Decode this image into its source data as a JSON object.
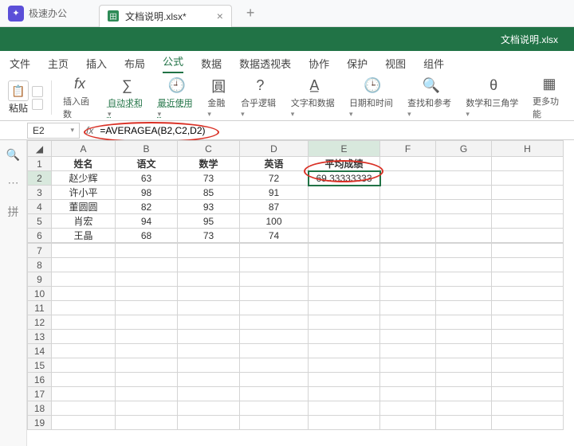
{
  "app": {
    "name": "极速办公"
  },
  "doc": {
    "tab_label": "文档说明.xlsx*",
    "header_title": "文档说明.xlsx"
  },
  "menu": {
    "file": "文件",
    "home": "主页",
    "insert": "插入",
    "layout": "布局",
    "formula": "公式",
    "data": "数据",
    "pivot": "数据透视表",
    "collab": "协作",
    "protect": "保护",
    "view": "视图",
    "addin": "组件"
  },
  "ribbon": {
    "paste": "粘贴",
    "insert_fn": "插入函数",
    "autosum": "自动求和",
    "recent": "最近使用",
    "finance": "金融",
    "logical": "合乎逻辑",
    "text_data": "文字和数据",
    "datetime": "日期和时间",
    "lookup": "查找和参考",
    "math": "数学和三角学",
    "more": "更多功能"
  },
  "fbar": {
    "cellref": "E2",
    "fx": "fx",
    "formula": "=AVERAGEA(B2,C2,D2)"
  },
  "sheet": {
    "cols": [
      "A",
      "B",
      "C",
      "D",
      "E",
      "F",
      "G",
      "H"
    ],
    "headers": {
      "name": "姓名",
      "lang": "语文",
      "math": "数学",
      "eng": "英语",
      "avg": "平均成绩"
    },
    "rows": [
      {
        "n": "赵少辉",
        "a": "63",
        "b": "73",
        "c": "72",
        "avg": "69.33333333"
      },
      {
        "n": "许小平",
        "a": "98",
        "b": "85",
        "c": "91",
        "avg": ""
      },
      {
        "n": "董圆圆",
        "a": "82",
        "b": "93",
        "c": "87",
        "avg": ""
      },
      {
        "n": "肖宏",
        "a": "94",
        "b": "95",
        "c": "100",
        "avg": ""
      },
      {
        "n": "王晶",
        "a": "68",
        "b": "73",
        "c": "74",
        "avg": ""
      }
    ]
  }
}
